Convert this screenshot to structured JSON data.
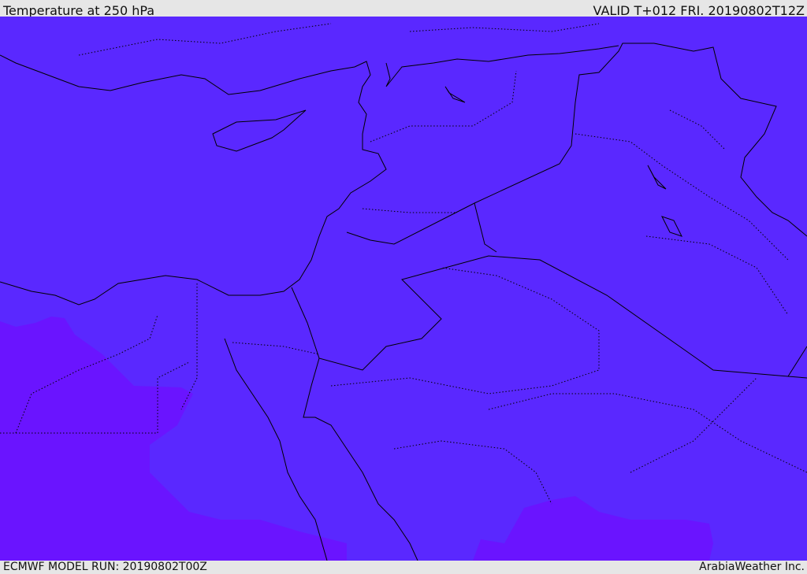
{
  "header": {
    "title": "Temperature at 250 hPa",
    "valid": "VALID T+012 FRI. 20190802T12Z"
  },
  "footer": {
    "model_run": "ECMWF MODEL RUN: 20190802T00Z",
    "credit": "ArabiaWeather Inc."
  },
  "colors": {
    "main_fill": "#5a28ff",
    "cold_fill": "#6a14ff",
    "background": "#e6e6e6",
    "line": "#000000"
  }
}
